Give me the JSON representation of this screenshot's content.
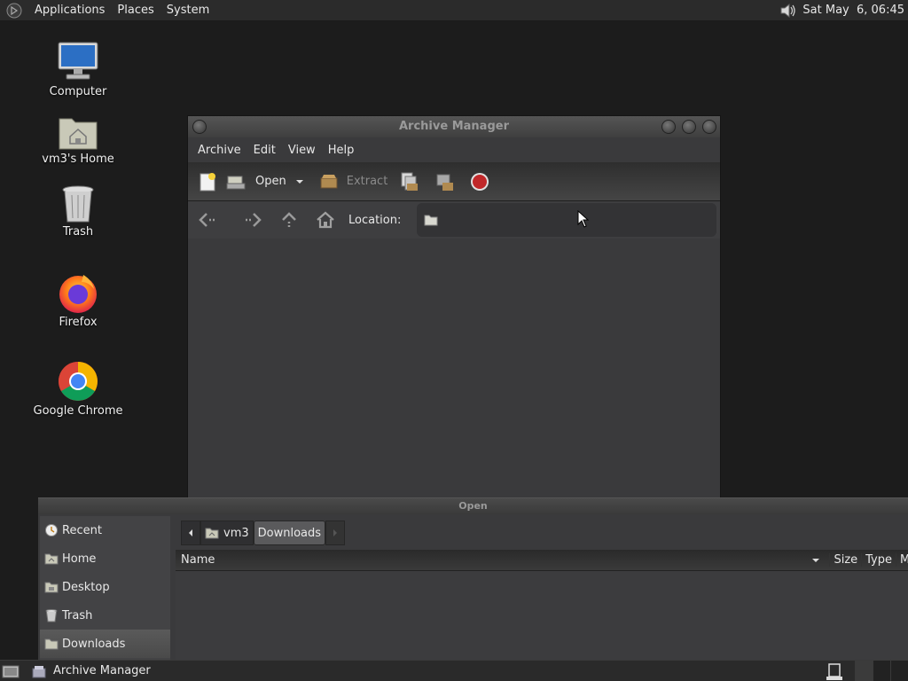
{
  "top_panel": {
    "menus": [
      "Applications",
      "Places",
      "System"
    ],
    "clock": "Sat May  6, 06:45",
    "icons": [
      "gnome-foot-logo",
      "volume-icon"
    ]
  },
  "desktop": {
    "icons": [
      {
        "label": "Computer",
        "icon": "computer-icon"
      },
      {
        "label": "vm3's Home",
        "icon": "home-folder-icon"
      },
      {
        "label": "Trash",
        "icon": "trash-icon"
      },
      {
        "label": "Firefox",
        "icon": "firefox-icon"
      },
      {
        "label": "Google Chrome",
        "icon": "chrome-icon"
      }
    ]
  },
  "archive_window": {
    "title": "Archive Manager",
    "menu": [
      "Archive",
      "Edit",
      "View",
      "Help"
    ],
    "toolbar": {
      "open_label": "Open",
      "extract_label": "Extract"
    },
    "location_label": "Location:",
    "location_value": ""
  },
  "open_dialog": {
    "title": "Open",
    "places": [
      {
        "label": "Recent",
        "icon": "recent-icon"
      },
      {
        "label": "Home",
        "icon": "home-icon"
      },
      {
        "label": "Desktop",
        "icon": "desktop-icon"
      },
      {
        "label": "Trash",
        "icon": "trash-icon"
      },
      {
        "label": "Downloads",
        "icon": "folder-icon",
        "selected": true
      }
    ],
    "path": [
      "vm3",
      "Downloads"
    ],
    "columns": {
      "name": "Name",
      "size": "Size",
      "type": "Type",
      "modified": "M"
    }
  },
  "bottom_panel": {
    "task_label": "Archive Manager"
  },
  "colors": {
    "panel_bg": "#2b2b2b",
    "desktop_bg": "#1c1c1c",
    "window_bg": "#3a3a3c",
    "stop_red": "#c0282a"
  }
}
